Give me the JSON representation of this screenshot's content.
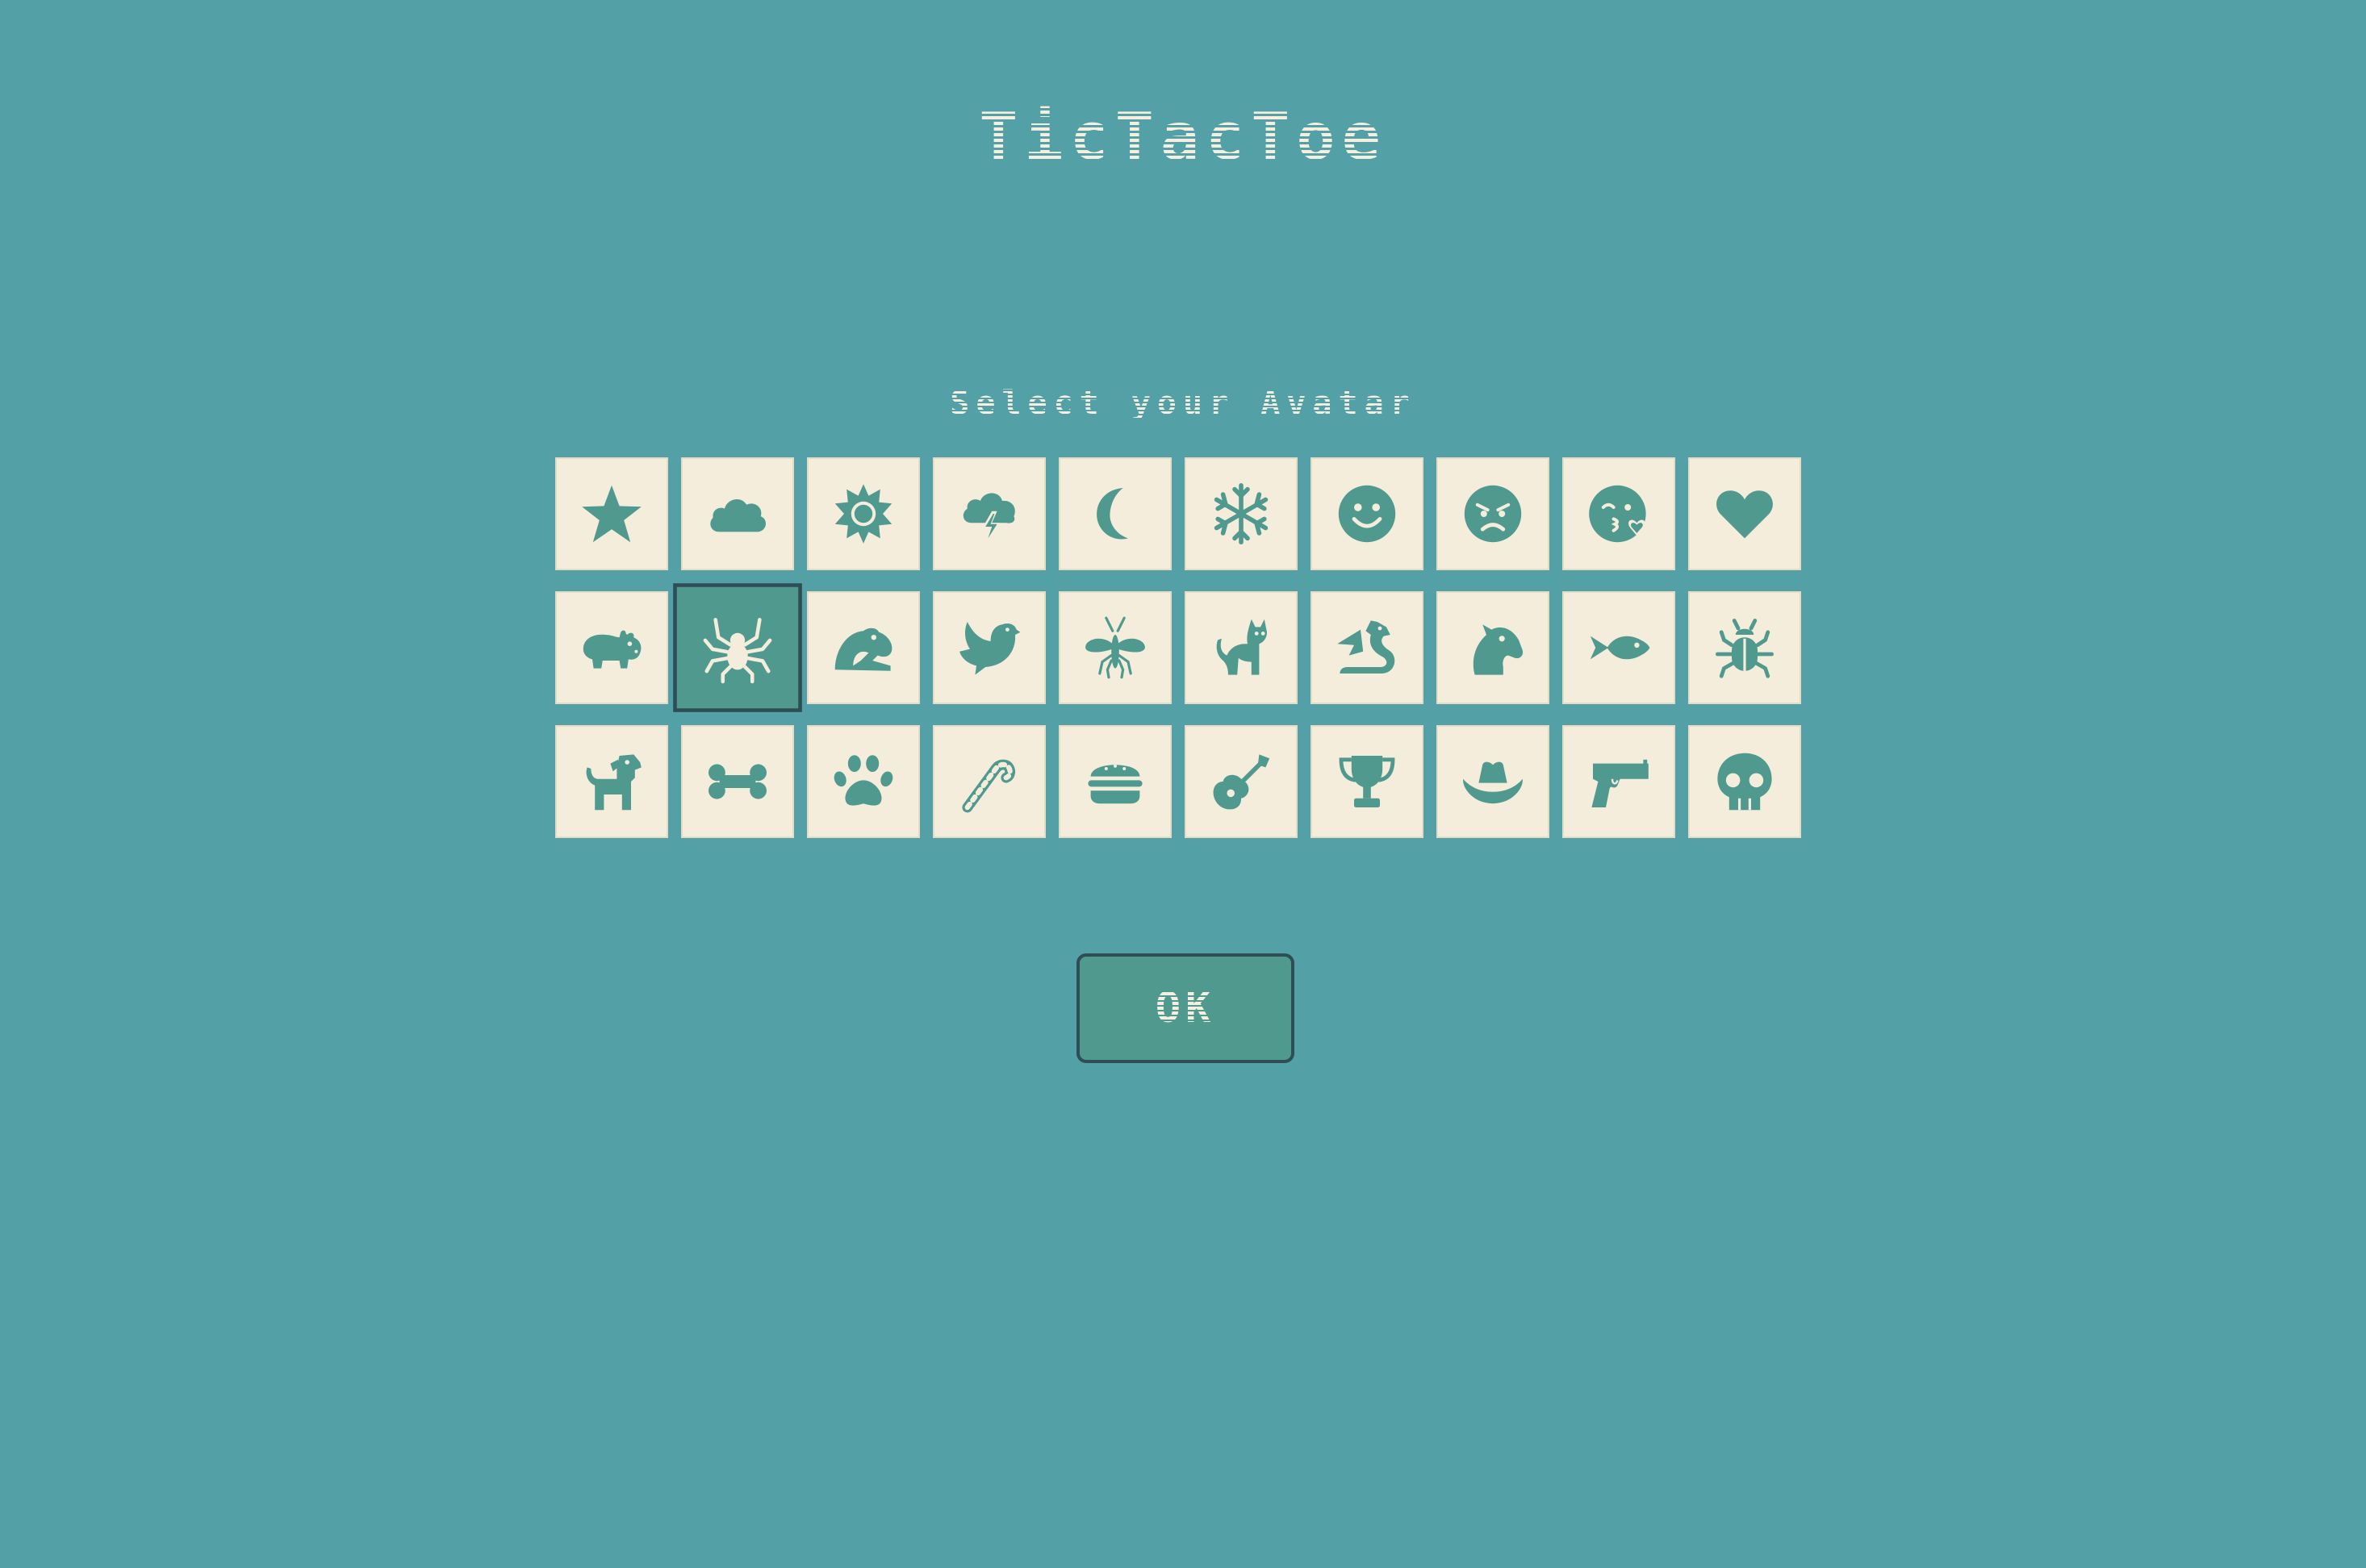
{
  "header": {
    "title": "TicTacToe"
  },
  "avatar_select": {
    "prompt": "Select your Avatar",
    "selected_icon": "spider-icon",
    "icons": [
      "star-icon",
      "cloud-icon",
      "sun-icon",
      "thunderstorm-icon",
      "moon-icon",
      "snowflake-icon",
      "smile-icon",
      "angry-face-icon",
      "kiss-face-icon",
      "heart-icon",
      "hippo-icon",
      "spider-icon",
      "frog-icon",
      "dove-icon",
      "mosquito-icon",
      "cat-icon",
      "dragon-icon",
      "horse-head-icon",
      "fish-icon",
      "bug-icon",
      "dog-icon",
      "bone-icon",
      "paw-icon",
      "candy-cane-icon",
      "burger-icon",
      "guitar-icon",
      "trophy-icon",
      "cowboy-hat-icon",
      "gun-icon",
      "skull-icon"
    ]
  },
  "actions": {
    "ok_label": "OK"
  },
  "colors": {
    "background": "#53a0a6",
    "tile": "#f5eddc",
    "icon": "#4f998f",
    "selected_border": "#2e4d55"
  }
}
